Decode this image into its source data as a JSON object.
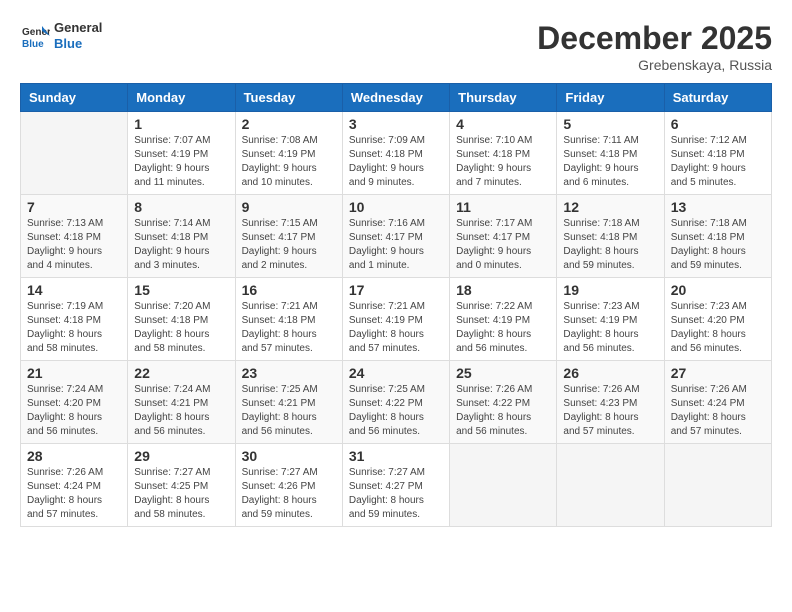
{
  "logo": {
    "general": "General",
    "blue": "Blue"
  },
  "title": "December 2025",
  "subtitle": "Grebenskaya, Russia",
  "days_of_week": [
    "Sunday",
    "Monday",
    "Tuesday",
    "Wednesday",
    "Thursday",
    "Friday",
    "Saturday"
  ],
  "weeks": [
    [
      {
        "day": "",
        "info": ""
      },
      {
        "day": "1",
        "info": "Sunrise: 7:07 AM\nSunset: 4:19 PM\nDaylight: 9 hours\nand 11 minutes."
      },
      {
        "day": "2",
        "info": "Sunrise: 7:08 AM\nSunset: 4:19 PM\nDaylight: 9 hours\nand 10 minutes."
      },
      {
        "day": "3",
        "info": "Sunrise: 7:09 AM\nSunset: 4:18 PM\nDaylight: 9 hours\nand 9 minutes."
      },
      {
        "day": "4",
        "info": "Sunrise: 7:10 AM\nSunset: 4:18 PM\nDaylight: 9 hours\nand 7 minutes."
      },
      {
        "day": "5",
        "info": "Sunrise: 7:11 AM\nSunset: 4:18 PM\nDaylight: 9 hours\nand 6 minutes."
      },
      {
        "day": "6",
        "info": "Sunrise: 7:12 AM\nSunset: 4:18 PM\nDaylight: 9 hours\nand 5 minutes."
      }
    ],
    [
      {
        "day": "7",
        "info": "Sunrise: 7:13 AM\nSunset: 4:18 PM\nDaylight: 9 hours\nand 4 minutes."
      },
      {
        "day": "8",
        "info": "Sunrise: 7:14 AM\nSunset: 4:18 PM\nDaylight: 9 hours\nand 3 minutes."
      },
      {
        "day": "9",
        "info": "Sunrise: 7:15 AM\nSunset: 4:17 PM\nDaylight: 9 hours\nand 2 minutes."
      },
      {
        "day": "10",
        "info": "Sunrise: 7:16 AM\nSunset: 4:17 PM\nDaylight: 9 hours\nand 1 minute."
      },
      {
        "day": "11",
        "info": "Sunrise: 7:17 AM\nSunset: 4:17 PM\nDaylight: 9 hours\nand 0 minutes."
      },
      {
        "day": "12",
        "info": "Sunrise: 7:18 AM\nSunset: 4:18 PM\nDaylight: 8 hours\nand 59 minutes."
      },
      {
        "day": "13",
        "info": "Sunrise: 7:18 AM\nSunset: 4:18 PM\nDaylight: 8 hours\nand 59 minutes."
      }
    ],
    [
      {
        "day": "14",
        "info": "Sunrise: 7:19 AM\nSunset: 4:18 PM\nDaylight: 8 hours\nand 58 minutes."
      },
      {
        "day": "15",
        "info": "Sunrise: 7:20 AM\nSunset: 4:18 PM\nDaylight: 8 hours\nand 58 minutes."
      },
      {
        "day": "16",
        "info": "Sunrise: 7:21 AM\nSunset: 4:18 PM\nDaylight: 8 hours\nand 57 minutes."
      },
      {
        "day": "17",
        "info": "Sunrise: 7:21 AM\nSunset: 4:19 PM\nDaylight: 8 hours\nand 57 minutes."
      },
      {
        "day": "18",
        "info": "Sunrise: 7:22 AM\nSunset: 4:19 PM\nDaylight: 8 hours\nand 56 minutes."
      },
      {
        "day": "19",
        "info": "Sunrise: 7:23 AM\nSunset: 4:19 PM\nDaylight: 8 hours\nand 56 minutes."
      },
      {
        "day": "20",
        "info": "Sunrise: 7:23 AM\nSunset: 4:20 PM\nDaylight: 8 hours\nand 56 minutes."
      }
    ],
    [
      {
        "day": "21",
        "info": "Sunrise: 7:24 AM\nSunset: 4:20 PM\nDaylight: 8 hours\nand 56 minutes."
      },
      {
        "day": "22",
        "info": "Sunrise: 7:24 AM\nSunset: 4:21 PM\nDaylight: 8 hours\nand 56 minutes."
      },
      {
        "day": "23",
        "info": "Sunrise: 7:25 AM\nSunset: 4:21 PM\nDaylight: 8 hours\nand 56 minutes."
      },
      {
        "day": "24",
        "info": "Sunrise: 7:25 AM\nSunset: 4:22 PM\nDaylight: 8 hours\nand 56 minutes."
      },
      {
        "day": "25",
        "info": "Sunrise: 7:26 AM\nSunset: 4:22 PM\nDaylight: 8 hours\nand 56 minutes."
      },
      {
        "day": "26",
        "info": "Sunrise: 7:26 AM\nSunset: 4:23 PM\nDaylight: 8 hours\nand 57 minutes."
      },
      {
        "day": "27",
        "info": "Sunrise: 7:26 AM\nSunset: 4:24 PM\nDaylight: 8 hours\nand 57 minutes."
      }
    ],
    [
      {
        "day": "28",
        "info": "Sunrise: 7:26 AM\nSunset: 4:24 PM\nDaylight: 8 hours\nand 57 minutes."
      },
      {
        "day": "29",
        "info": "Sunrise: 7:27 AM\nSunset: 4:25 PM\nDaylight: 8 hours\nand 58 minutes."
      },
      {
        "day": "30",
        "info": "Sunrise: 7:27 AM\nSunset: 4:26 PM\nDaylight: 8 hours\nand 59 minutes."
      },
      {
        "day": "31",
        "info": "Sunrise: 7:27 AM\nSunset: 4:27 PM\nDaylight: 8 hours\nand 59 minutes."
      },
      {
        "day": "",
        "info": ""
      },
      {
        "day": "",
        "info": ""
      },
      {
        "day": "",
        "info": ""
      }
    ]
  ]
}
